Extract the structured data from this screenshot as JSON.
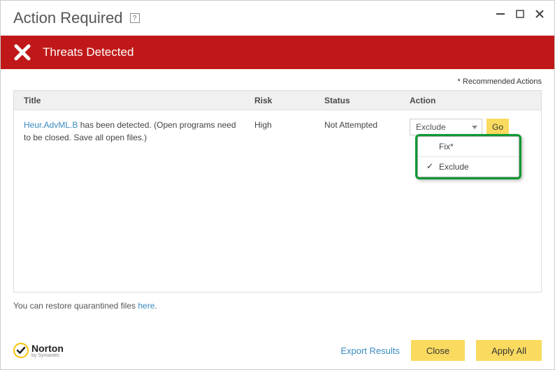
{
  "title": "Action Required",
  "banner": {
    "title": "Threats Detected"
  },
  "recommended_label": "* Recommended Actions",
  "columns": {
    "title": "Title",
    "risk": "Risk",
    "status": "Status",
    "action": "Action"
  },
  "threat": {
    "name": "Heur.AdvML.B",
    "description": " has been detected. (Open programs need to be closed. Save all open files.)",
    "risk": "High",
    "status": "Not Attempted",
    "selected_action": "Exclude",
    "go_label": "Go"
  },
  "dropdown": {
    "options": [
      "Fix*",
      "Exclude"
    ],
    "selected": "Exclude"
  },
  "restore": {
    "text_before": "You can restore quarantined files ",
    "link": "here",
    "text_after": "."
  },
  "logo": {
    "name": "Norton",
    "sub": "by Symantec"
  },
  "footer": {
    "export": "Export Results",
    "close": "Close",
    "apply": "Apply All"
  }
}
